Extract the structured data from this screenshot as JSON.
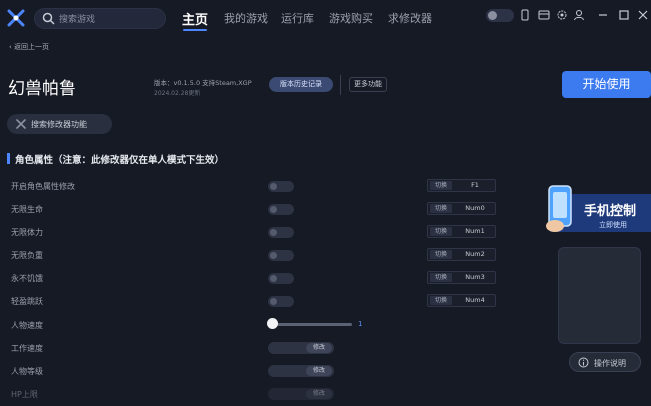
{
  "header": {
    "search_placeholder": "搜索游戏",
    "nav": [
      "主页",
      "我的游戏",
      "运行库",
      "游戏购买",
      "求修改器"
    ]
  },
  "game": {
    "back_label": "返回上一页",
    "title": "幻兽帕鲁",
    "version_line": "版本：v0.1.5.0 支持Steam,XGP",
    "updated_line": "2024.02.28更新",
    "history_button": "版本历史记录",
    "more_button": "更多功能",
    "start_button": "开始使用",
    "search_feature": "搜索修改器功能"
  },
  "section": {
    "title": "角色属性（注意：此修改器仅在单人模式下生效）"
  },
  "toggles": [
    {
      "label": "开启角色属性修改",
      "switch_label": "切换",
      "key": "F1"
    },
    {
      "label": "无限生命",
      "switch_label": "切换",
      "key": "Num0"
    },
    {
      "label": "无限体力",
      "switch_label": "切换",
      "key": "Num1"
    },
    {
      "label": "无限负重",
      "switch_label": "切换",
      "key": "Num2"
    },
    {
      "label": "永不饥饿",
      "switch_label": "切换",
      "key": "Num3"
    },
    {
      "label": "轻盈跳跃",
      "switch_label": "切换",
      "key": "Num4"
    }
  ],
  "speed": {
    "label": "人物速度",
    "value": "1"
  },
  "modifiers": [
    {
      "label": "工作速度",
      "button": "修改"
    },
    {
      "label": "人物等级",
      "button": "修改"
    },
    {
      "label": "HP上限",
      "button": "修改"
    }
  ],
  "promo": {
    "title": "手机控制",
    "subtitle": "立即使用"
  },
  "help": {
    "label": "操作说明"
  },
  "colors": {
    "accent": "#3c7af0",
    "background": "#161a24"
  }
}
